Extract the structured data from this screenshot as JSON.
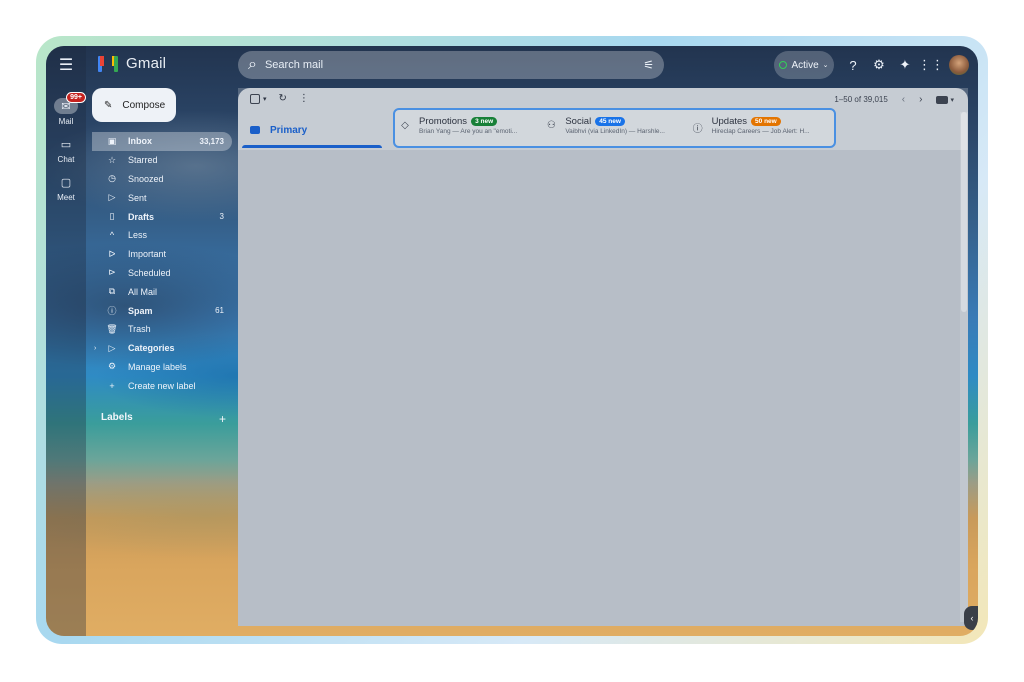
{
  "app": {
    "name": "Gmail"
  },
  "rail": {
    "mail_badge": "99+",
    "items": [
      {
        "label": "Mail",
        "icon": "mail-icon"
      },
      {
        "label": "Chat",
        "icon": "chat-icon"
      },
      {
        "label": "Meet",
        "icon": "video-icon"
      }
    ]
  },
  "header": {
    "search_placeholder": "Search mail",
    "status": "Active"
  },
  "compose": {
    "label": "Compose"
  },
  "nav": [
    {
      "label": "Inbox",
      "count": "33,173",
      "icon": "inbox-icon",
      "active": true
    },
    {
      "label": "Starred",
      "count": "",
      "icon": "star-icon"
    },
    {
      "label": "Snoozed",
      "count": "",
      "icon": "clock-icon"
    },
    {
      "label": "Sent",
      "count": "",
      "icon": "send-icon"
    },
    {
      "label": "Drafts",
      "count": "3",
      "icon": "draft-icon",
      "bold": true
    },
    {
      "label": "Less",
      "count": "",
      "icon": "chevron-up-icon"
    },
    {
      "label": "Important",
      "count": "",
      "icon": "important-icon"
    },
    {
      "label": "Scheduled",
      "count": "",
      "icon": "scheduled-icon"
    },
    {
      "label": "All Mail",
      "count": "",
      "icon": "all-mail-icon"
    },
    {
      "label": "Spam",
      "count": "61",
      "icon": "spam-icon",
      "bold": true
    },
    {
      "label": "Trash",
      "count": "",
      "icon": "trash-icon"
    },
    {
      "label": "Categories",
      "count": "",
      "icon": "label-icon",
      "bold": true
    },
    {
      "label": "Manage labels",
      "count": "",
      "icon": "gear-icon"
    },
    {
      "label": "Create new label",
      "count": "",
      "icon": "plus-icon"
    }
  ],
  "labels": {
    "title": "Labels"
  },
  "toolbar": {
    "pagination": "1–50 of 39,015"
  },
  "tabs": {
    "primary": "Primary",
    "categories": [
      {
        "title": "Promotions",
        "badge": "3 new",
        "badge_color": "#188038",
        "sub": "Brian Yang — Are you an \"emoti...",
        "icon": "tag-icon"
      },
      {
        "title": "Social",
        "badge": "45 new",
        "badge_color": "#1a73e8",
        "sub": "Vaibhvi (via LinkedIn) — Harshle...",
        "icon": "people-icon"
      },
      {
        "title": "Updates",
        "badge": "50 new",
        "badge_color": "#e37400",
        "sub": "Hireclap Careers — Job Alert: H...",
        "icon": "info-icon"
      }
    ]
  }
}
